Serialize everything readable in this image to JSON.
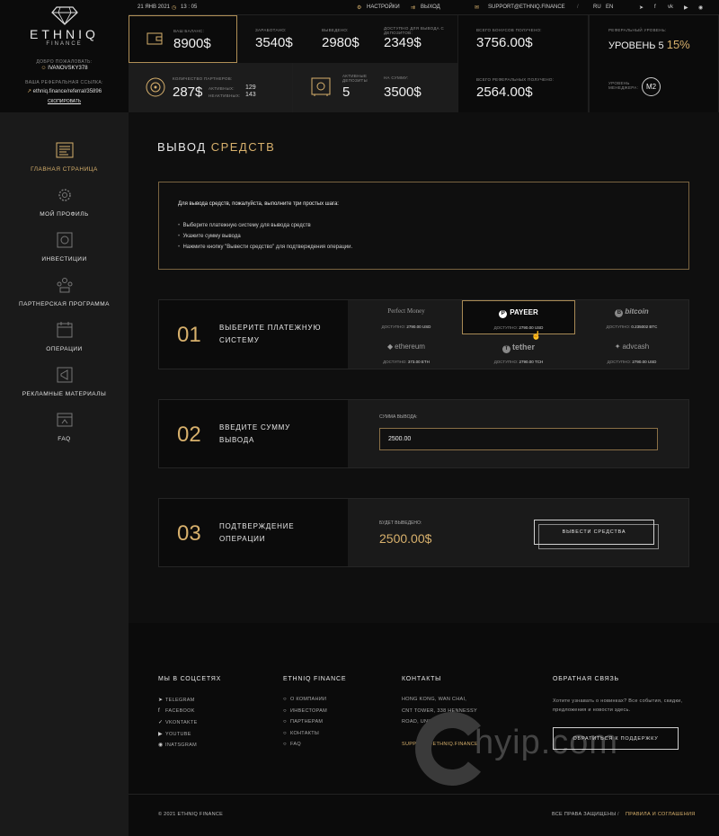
{
  "brand": {
    "name": "ETHNIQ",
    "sub": "FINANCE"
  },
  "user": {
    "welcome": "ДОБРО ПОЖАЛОВАТЬ:",
    "username": "IVANOVSKY378",
    "ref_label": "ВАША РЕФЕРАЛЬНАЯ ССЫЛКА:",
    "ref_link": "ethniq.finance/referral/35896",
    "copy": "СКОПИРОВАТЬ"
  },
  "topbar": {
    "date": "21 ЯНВ 2021",
    "time": "13 : 05",
    "settings": "НАСТРОЙКИ",
    "logout": "ВЫХОД",
    "support_email": "SUPPORT@ETHNIQ.FINANCE",
    "lang_ru": "RU",
    "lang_en": "EN"
  },
  "stats": {
    "balance_label": "ВАШ БАЛАНС:",
    "balance": "8900$",
    "earned_label": "ЗАРАБОТАНО:",
    "earned": "3540$",
    "withdrawn_label": "ВЫВЕДЕНО:",
    "withdrawn": "2980$",
    "available_label": "ДОСТУПНО ДЛЯ ВЫВОДА С ДЕПОЗИТОВ:",
    "available": "2349$",
    "bonus_label": "ВСЕГО БОНУСОВ ПОЛУЧЕНО:",
    "bonus": "3756.00$",
    "ref_level_label": "РЕФЕРАЛЬНЫЙ УРОВЕНЬ:",
    "ref_level": "УРОВЕНЬ 5",
    "ref_percent": "15%",
    "partners_label": "КОЛИЧЕСТВО ПАРТНЕРОВ:",
    "partners": "287$",
    "active_label": "АКТИВНЫХ:",
    "active_count": "129",
    "inactive_label": "НЕАКТИВНЫХ:",
    "inactive_count": "143",
    "active_deposits_label": "АКТИВНЫЕ ДЕПОЗИТЫ",
    "active_deposits": "5",
    "sum_label": "НА СУММУ:",
    "sum": "3500$",
    "ref_total_label": "ВСЕГО РЕФЕРАЛЬНЫХ ПОЛУЧЕНО:",
    "ref_total": "2564.00$",
    "manager_label": "УРОВЕНЬ МЕНЕДЖЕРА:",
    "manager_level": "M2"
  },
  "nav": [
    {
      "label": "ГЛАВНАЯ СТРАНИЦА",
      "icon": "dashboard-icon"
    },
    {
      "label": "МОЙ ПРОФИЛЬ",
      "icon": "gear-icon"
    },
    {
      "label": "ИНВЕСТИЦИИ",
      "icon": "safe-icon"
    },
    {
      "label": "ПАРТНЕРСКАЯ ПРОГРАММА",
      "icon": "partners-icon"
    },
    {
      "label": "ОПЕРАЦИИ",
      "icon": "calendar-icon"
    },
    {
      "label": "РЕКЛАМНЫЕ МАТЕРИАЛЫ",
      "icon": "megaphone-icon"
    },
    {
      "label": "FAQ",
      "icon": "browser-icon"
    }
  ],
  "page": {
    "title": "ВЫВОД",
    "title_accent": "СРЕДСТВ",
    "intro": "Для вывода средств, пожалуйста, выполните три простых шага:",
    "steps_list": [
      "Выберите платежную систему для вывода средств",
      "Укажите сумму вывода",
      "Нажмите кнопку \"Вывести средство\" для подтверждения операции."
    ]
  },
  "step1": {
    "num": "01",
    "title": "ВЫБЕРИТЕ ПЛАТЕЖНУЮ СИСТЕМУ",
    "avail_label": "ДОСТУПНО:",
    "systems": [
      {
        "name": "Perfect Money",
        "amount": "2790.00 USD"
      },
      {
        "name": "PAYEER",
        "amount": "2790.00 USD"
      },
      {
        "name": "bitcoin",
        "amount": "0.235002 BTC"
      },
      {
        "name": "ethereum",
        "amount": "373.00 ETH"
      },
      {
        "name": "tether",
        "amount": "2790.00 TCH"
      },
      {
        "name": "advcash",
        "amount": "2790.00 USD"
      }
    ]
  },
  "step2": {
    "num": "02",
    "title": "ВВЕДИТЕ СУММУ ВЫВОДА",
    "field_label": "СУММА ВЫВОДА:",
    "value": "2500.00"
  },
  "step3": {
    "num": "03",
    "title": "ПОДТВЕРЖДЕНИЕ ОПЕРАЦИИ",
    "out_label": "БУДЕТ ВЫВЕДЕНО:",
    "out_value": "2500.00$",
    "button": "ВЫВЕСТИ СРЕДСТВА"
  },
  "footer": {
    "social_title": "МЫ В СОЦСЕТЯХ",
    "social": [
      "TELEGRAM",
      "FACEBOOK",
      "VKONTAKTE",
      "YOUTUBE",
      "INATSGRAM"
    ],
    "company_title": "ETHNIQ FINANCE",
    "company": [
      "О КОМПАНИИ",
      "ИНВЕСТОРАМ",
      "ПАРТНЕРАМ",
      "КОНТАКТЫ",
      "FAQ"
    ],
    "contacts_title": "КОНТАКТЫ",
    "address": [
      "HONG KONG, WAN CHAI,",
      "CNT TOWER, 338 HENNESSY",
      "ROAD, UNIT 5, 26/F"
    ],
    "email": "SUPPORT@ETHNIQ.FINANCE",
    "feedback_title": "ОБРАТНАЯ СВЯЗЬ",
    "feedback_text": "Хотите узнавать о новинках? Все события, скидки, предложения и новости здесь.",
    "support_button": "ОБРАТИТЬСЯ К ПОДДЕРЖКУ",
    "copyright": "© 2021 ETHNIQ FINANCE",
    "rights": "ВСЕ ПРАВА ЗАЩИЩЕНЫ",
    "terms": "ПРАВИЛА И СОГЛАШЕНИЯ",
    "watermark": "hyip.com"
  },
  "colors": {
    "accent": "#d7b06c",
    "bg": "#141414"
  }
}
